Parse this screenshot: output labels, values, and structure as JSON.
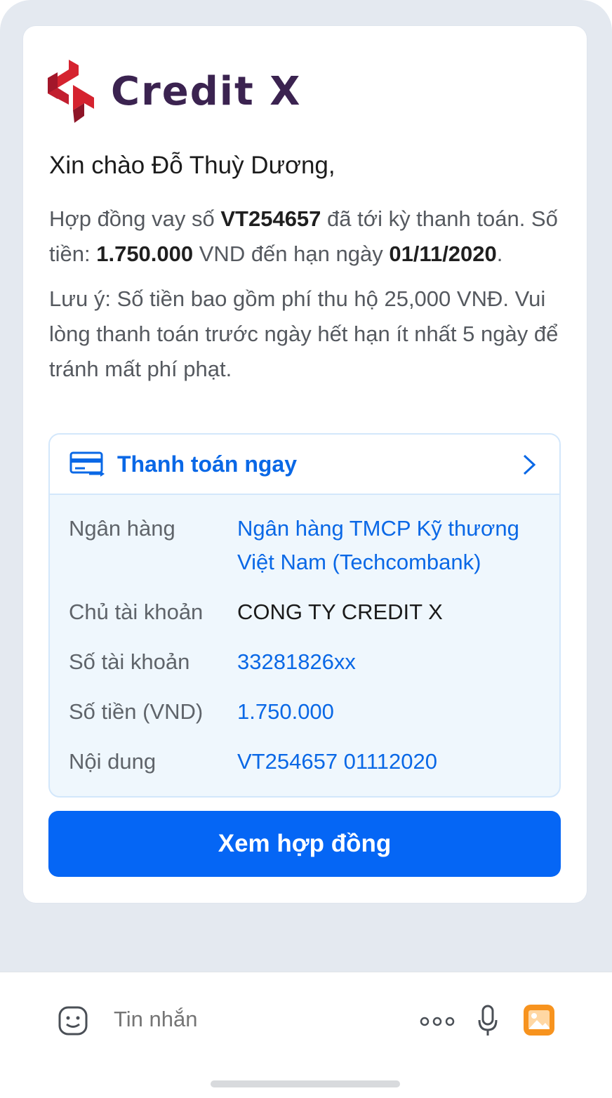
{
  "brand": {
    "name": "Credit X"
  },
  "message": {
    "greeting": "Xin chào Đỗ Thuỳ Dương,",
    "p1_pre": "Hợp đồng vay số ",
    "contract_no": "VT254657",
    "p1_mid": " đã tới kỳ thanh toán. Số tiền: ",
    "amount": "1.750.000",
    "p1_mid2": " VND đến hạn ngày ",
    "due_date": "01/11/2020",
    "p1_end": ".",
    "note": "Lưu ý: Số tiền bao gồm phí thu hộ 25,000 VNĐ. Vui lòng thanh toán trước ngày hết hạn ít nhất 5 ngày để tránh mất phí phạt."
  },
  "payment": {
    "header_label": "Thanh toán ngay",
    "rows": [
      {
        "label": "Ngân hàng",
        "value": "Ngân hàng TMCP Kỹ thương Việt Nam (Techcombank)"
      },
      {
        "label": "Chủ tài khoản",
        "value": "CONG TY CREDIT X"
      },
      {
        "label": "Số tài khoản",
        "value": "33281826xx"
      },
      {
        "label": "Số tiền (VND)",
        "value": "1.750.000"
      },
      {
        "label": "Nội dung",
        "value": "VT254657 01112020"
      }
    ]
  },
  "actions": {
    "view_contract": "Xem hợp đồng"
  },
  "composer": {
    "placeholder": "Tin nhắn",
    "icons": [
      "emoji-icon",
      "more-icon",
      "microphone-icon",
      "image-icon"
    ]
  },
  "colors": {
    "accent": "#0566f5",
    "link": "#0a68e6",
    "brand_text": "#3b2350",
    "brand_logo": "#c8202f",
    "image_icon": "#f7931e"
  }
}
